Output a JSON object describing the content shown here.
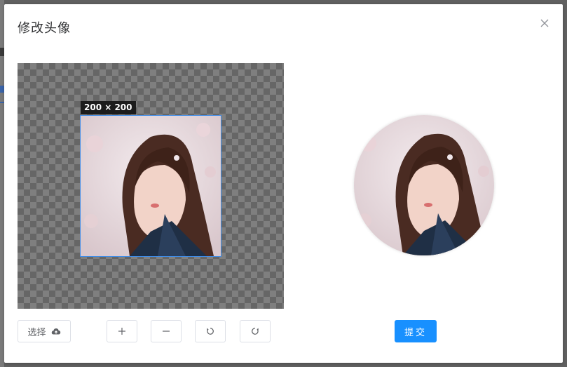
{
  "dialog": {
    "title": "修改头像",
    "close_icon": "close-icon"
  },
  "cropper": {
    "size_label": "200 × 200",
    "background": "checkerboard",
    "image_subject": "portrait-photo"
  },
  "toolbar": {
    "select_label": "选择",
    "select_icon": "cloud-upload-icon",
    "zoom_in_icon": "plus-icon",
    "zoom_out_icon": "minus-icon",
    "rotate_left_icon": "rotate-left-icon",
    "rotate_right_icon": "rotate-right-icon"
  },
  "submit": {
    "label": "提交"
  },
  "colors": {
    "primary": "#1890ff",
    "crop_border": "#3f8ce8",
    "badge_bg": "#1c1c1c"
  }
}
